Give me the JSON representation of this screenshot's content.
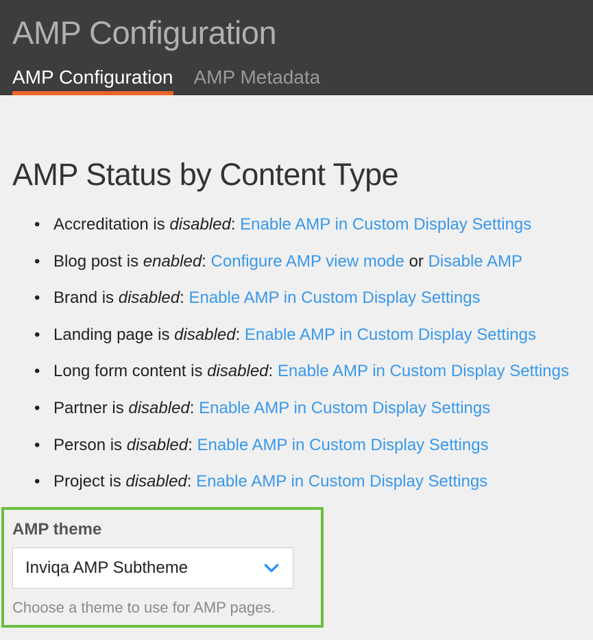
{
  "header": {
    "title": "AMP Configuration",
    "tabs": [
      {
        "label": "AMP Configuration"
      },
      {
        "label": "AMP Metadata"
      }
    ]
  },
  "section": {
    "title": "AMP Status by Content Type"
  },
  "content_types": [
    {
      "name": "Accreditation",
      "status": "disabled",
      "link_text": "Enable AMP in Custom Display Settings"
    },
    {
      "name": "Blog post",
      "status": "enabled",
      "link1_text": "Configure AMP view mode",
      "or_text": "or",
      "link2_text": "Disable AMP"
    },
    {
      "name": "Brand",
      "status": "disabled",
      "link_text": "Enable AMP in Custom Display Settings"
    },
    {
      "name": "Landing page",
      "status": "disabled",
      "link_text": "Enable AMP in Custom Display Settings"
    },
    {
      "name": "Long form content",
      "status": "disabled",
      "link_text": "Enable AMP in Custom Display Settings"
    },
    {
      "name": "Partner",
      "status": "disabled",
      "link_text": "Enable AMP in Custom Display Settings"
    },
    {
      "name": "Person",
      "status": "disabled",
      "link_text": "Enable AMP in Custom Display Settings"
    },
    {
      "name": "Project",
      "status": "disabled",
      "link_text": "Enable AMP in Custom Display Settings"
    }
  ],
  "theme": {
    "label": "AMP theme",
    "selected": "Inviqa AMP Subtheme",
    "description": "Choose a theme to use for AMP pages."
  },
  "separator_is": " is ",
  "separator_colon": ": "
}
